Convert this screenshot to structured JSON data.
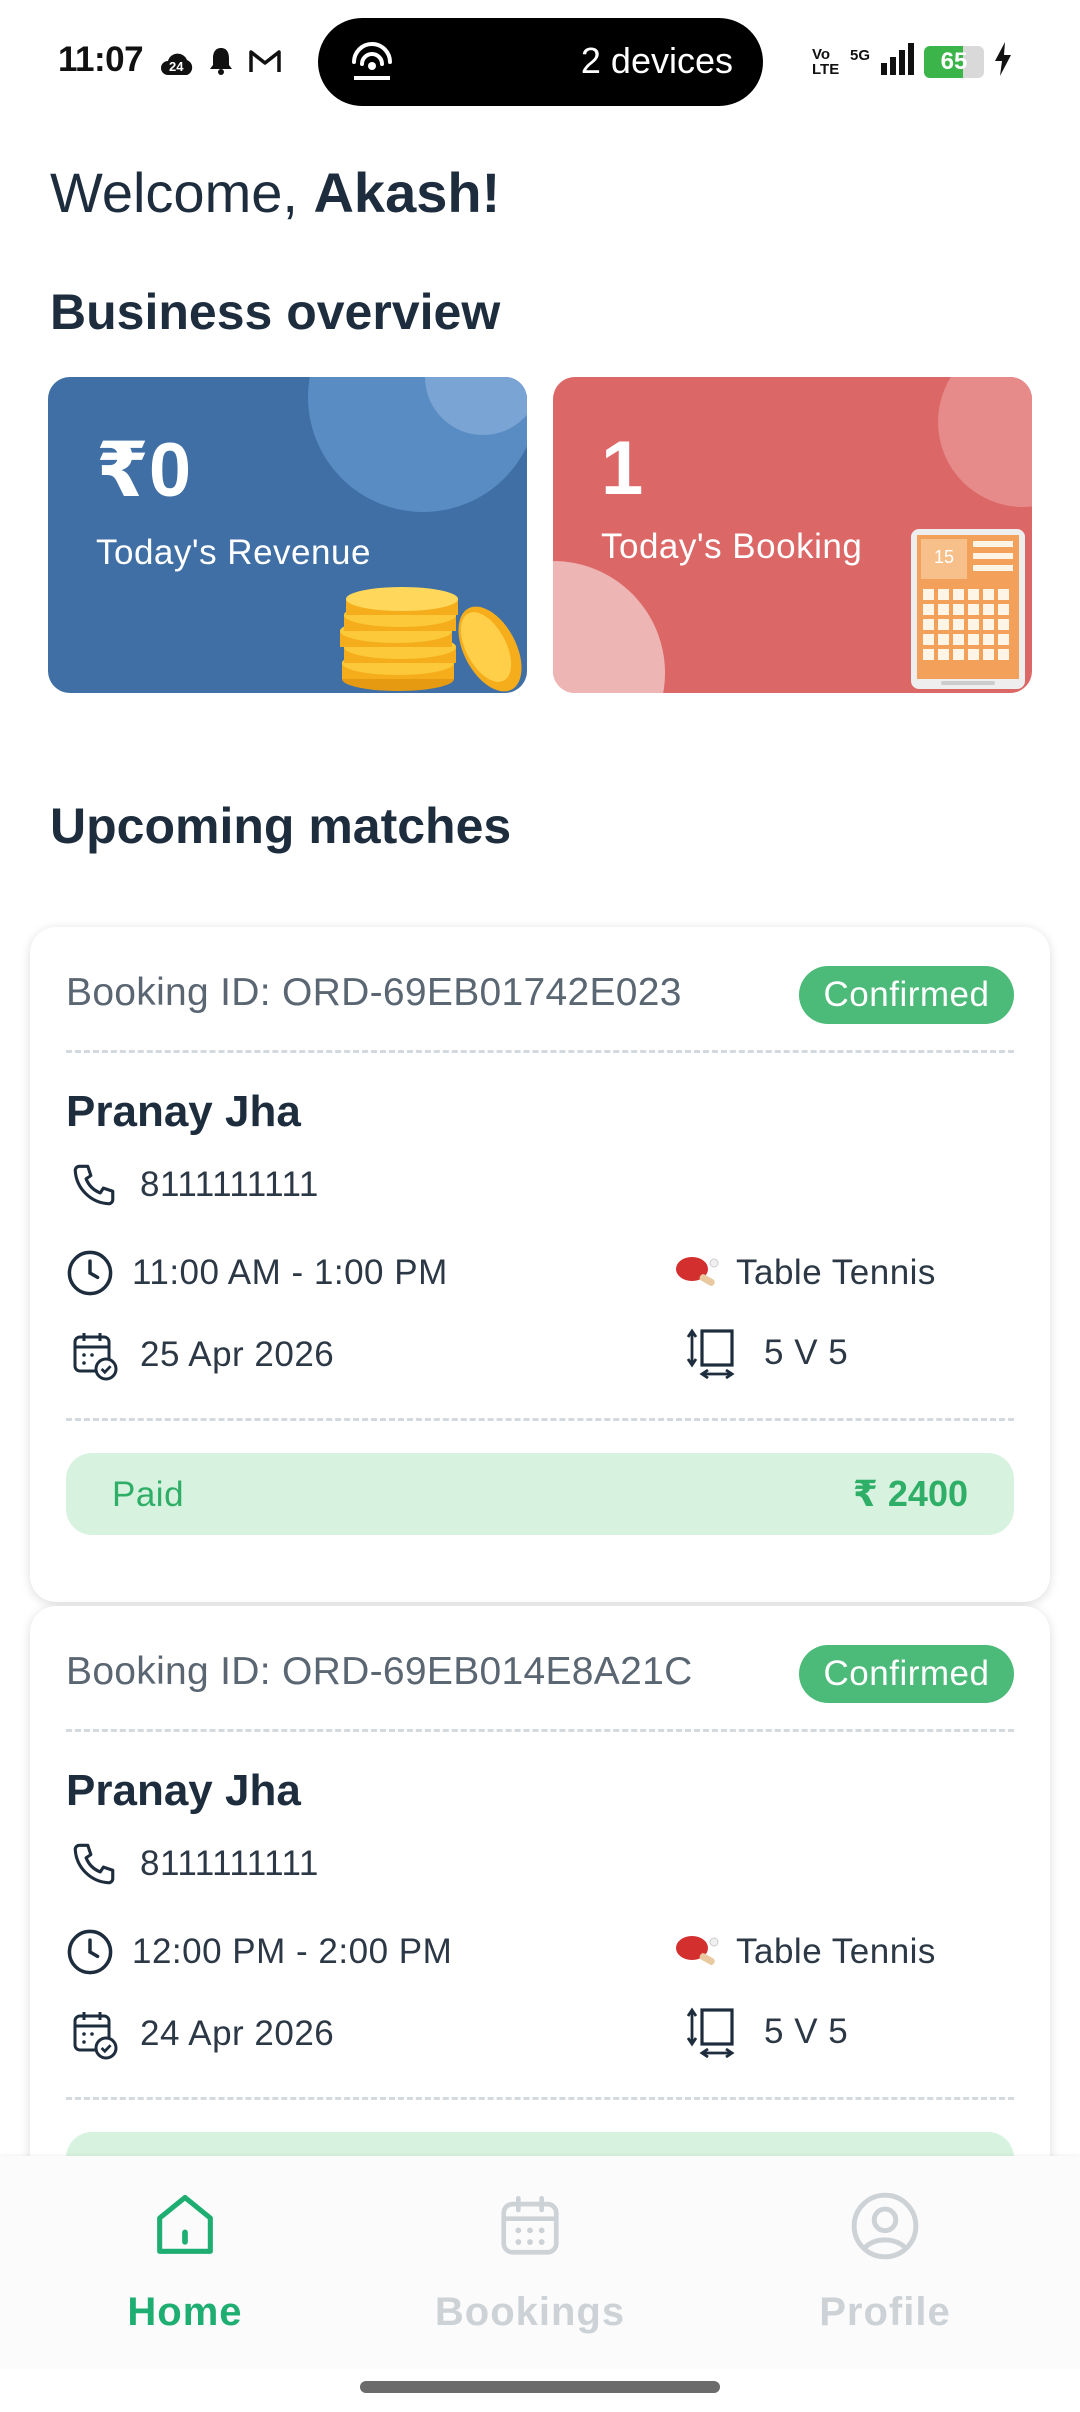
{
  "status_bar": {
    "time": "11:07",
    "notif_badge": "24",
    "hotspot_text": "2 devices",
    "volte_label": "Vo LTE",
    "network_label": "5G",
    "battery_level": "65",
    "battery_fraction": 0.65
  },
  "greeting": {
    "prefix": "Welcome, ",
    "name": "Akash!"
  },
  "overview": {
    "title": "Business overview",
    "revenue": {
      "value": "₹0",
      "label": "Today's Revenue"
    },
    "booking": {
      "value": "1",
      "label": "Today's Booking",
      "calendar_day": "15"
    }
  },
  "upcoming": {
    "title": "Upcoming matches",
    "matches": [
      {
        "booking_id": "Booking ID: ORD-69EB01742E023",
        "status": "Confirmed",
        "name": "Pranay Jha",
        "phone": "8111111111",
        "time": "11:00 AM - 1:00 PM",
        "sport": "Table Tennis",
        "date": "25 Apr 2026",
        "format": "5 V 5",
        "payment_status": "Paid",
        "amount": "₹ 2400"
      },
      {
        "booking_id": "Booking ID: ORD-69EB014E8A21C",
        "status": "Confirmed",
        "name": "Pranay Jha",
        "phone": "8111111111",
        "time": "12:00 PM - 2:00 PM",
        "sport": "Table Tennis",
        "date": "24 Apr 2026",
        "format": "5 V 5"
      }
    ]
  },
  "nav": {
    "home": "Home",
    "bookings": "Bookings",
    "profile": "Profile"
  },
  "colors": {
    "primary": "#1fae72",
    "revenue_card": "#3f6fa4",
    "booking_card": "#dc6767",
    "confirmed": "#4cba78",
    "paid_bg": "#d7f3e0"
  }
}
